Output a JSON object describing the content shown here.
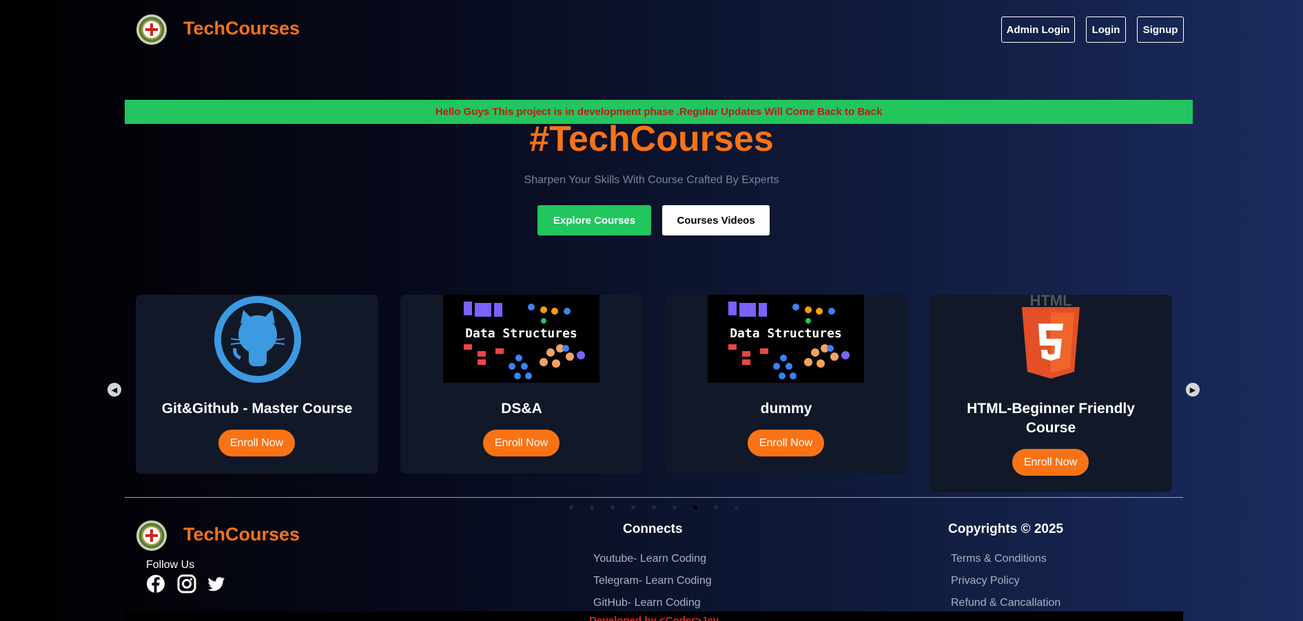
{
  "header": {
    "brand": "TechCourses",
    "buttons": {
      "admin_login": "Admin Login",
      "login": "Login",
      "signup": "Signup"
    }
  },
  "notice": "Hello Guys This project is in development phase .Regular Updates Will Come Back to Back",
  "hero": {
    "title": "#TechCourses",
    "subtitle": "Sharpen Your Skills With Course Crafted By Experts",
    "explore_label": "Explore Courses",
    "videos_label": "Courses Videos"
  },
  "courses": [
    {
      "title": "Git&Github - Master Course",
      "enroll": "Enroll Now",
      "image": "github-octocat-icon"
    },
    {
      "title": "DS&A",
      "enroll": "Enroll Now",
      "image": "data-structures-image",
      "image_text": "Data Structures"
    },
    {
      "title": "dummy",
      "enroll": "Enroll Now",
      "image": "data-structures-image",
      "image_text": "Data Structures"
    },
    {
      "title": "HTML-Beginner Friendly Course",
      "enroll": "Enroll Now",
      "image": "html5-logo-icon",
      "image_text": "HTML"
    }
  ],
  "carousel": {
    "dots": 9,
    "active_dot": 6
  },
  "footer": {
    "brand": "TechCourses",
    "follow_label": "Follow Us",
    "connects": {
      "title": "Connects",
      "links": [
        "Youtube- Learn Coding",
        "Telegram- Learn Coding",
        "GitHub- Learn Coding"
      ]
    },
    "copyrights": {
      "title": "Copyrights © 2025",
      "links": [
        "Terms & Conditions",
        "Privacy Policy",
        "Refund & Cancallation"
      ]
    },
    "developed_by": "Developed by <Coder>Jay"
  },
  "colors": {
    "accent": "#f97316",
    "green": "#22c55e",
    "card_bg": "#111827"
  }
}
